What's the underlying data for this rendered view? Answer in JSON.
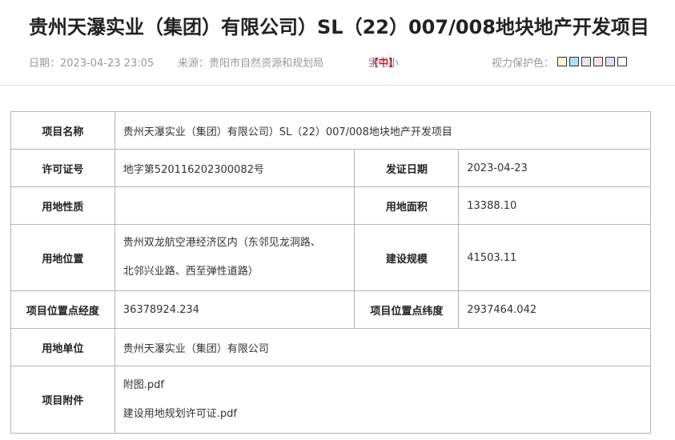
{
  "header": {
    "title": "贵州天瀑实业（集团）有限公司）SL（22）007/008地块地产开发项目",
    "date": "日期：2023-04-23 23:05",
    "source": "来源：贵阳市自然资源和规划局",
    "font_size_label": "字号：",
    "font_size_open": "【",
    "font_size_large": "大",
    "font_size_medium": "中",
    "font_size_small": "小",
    "font_size_close": "】",
    "eye_care_label": "视力保护色：",
    "eye_care_colors": [
      "#fafad2",
      "#b0e0f0",
      "#e6e6e6",
      "#f7e0e6",
      "#e6d9f2",
      "#ffffff"
    ]
  },
  "table": {
    "r1": {
      "k1": "项目名称",
      "v1": "贵州天瀑实业（集团）有限公司）SL（22）007/008地块地产开发项目"
    },
    "r2": {
      "k1": "许可证号",
      "v1": "地字第520116202300082号",
      "k2": "发证日期",
      "v2": "2023-04-23"
    },
    "r3": {
      "k1": "用地性质",
      "v1": "",
      "k2": "用地面积",
      "v2": "13388.10"
    },
    "r4": {
      "k1": "用地位置",
      "v1a": "贵州双龙航空港经济区内（东邻见龙洞路、",
      "v1b": "北邻兴业路、西至弹性道路）",
      "k2": "建设规模",
      "v2": "41503.11"
    },
    "r5": {
      "k1": "项目位置点经度",
      "v1": "36378924.234",
      "k2": "项目位置点纬度",
      "v2": "2937464.042"
    },
    "r6": {
      "k1": "用地单位",
      "v1": "贵州天瀑实业（集团）有限公司"
    },
    "r7": {
      "k1": "项目附件",
      "a1": "附图.pdf",
      "a2": "建设用地规划许可证.pdf"
    }
  }
}
